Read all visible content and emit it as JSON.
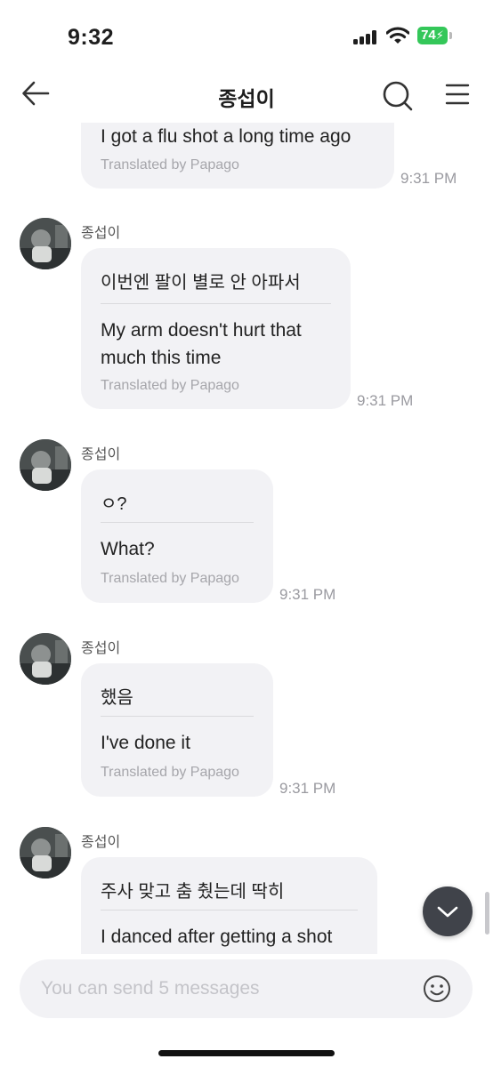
{
  "status_bar": {
    "time": "9:32",
    "battery": "74"
  },
  "header": {
    "title": "종섭이"
  },
  "messages": [
    {
      "sender": "",
      "original": "",
      "translation": "I got a flu shot a long time ago",
      "credit": "Translated by Papago",
      "time": "9:31 PM"
    },
    {
      "sender": "종섭이",
      "original": "이번엔 팔이 별로 안 아파서",
      "translation_line1": "My arm doesn't hurt that",
      "translation_line2": "much this time",
      "credit": "Translated by Papago",
      "time": "9:31 PM"
    },
    {
      "sender": "종섭이",
      "original": "ㅇ?",
      "translation": "What?",
      "credit": "Translated by Papago",
      "time": "9:31 PM"
    },
    {
      "sender": "종섭이",
      "original": "했음",
      "translation": "I've done it",
      "credit": "Translated by Papago",
      "time": "9:31 PM"
    },
    {
      "sender": "종섭이",
      "original": "주사 맞고 춤 췄는데 딱히",
      "translation": "I danced after getting a shot",
      "credit": "",
      "time": ""
    }
  ],
  "composer": {
    "placeholder": "You can send 5 messages"
  },
  "icons": {
    "back": "arrow-left-icon",
    "search": "search-icon",
    "menu": "hamburger-icon",
    "scroll_down": "chevron-down-icon",
    "emoji": "smiley-icon"
  },
  "colors": {
    "bubble": "#f2f2f5",
    "battery": "#34c759",
    "scroll_button": "#40434a"
  }
}
